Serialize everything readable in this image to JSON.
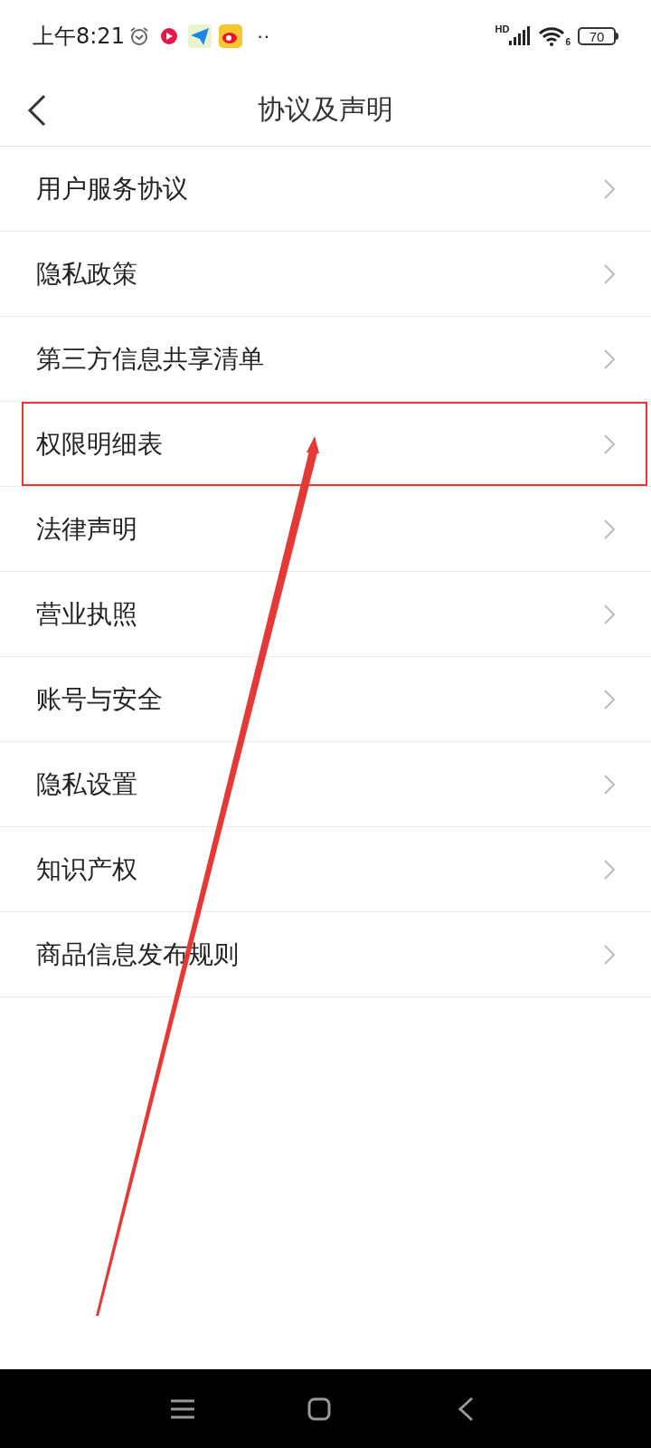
{
  "status_bar": {
    "time": "上午8:21",
    "network": "HD",
    "wifi_badge": "6",
    "battery": "70",
    "more": "··"
  },
  "header": {
    "title": "协议及声明"
  },
  "items": [
    {
      "label": "用户服务协议",
      "highlighted": false
    },
    {
      "label": "隐私政策",
      "highlighted": false
    },
    {
      "label": "第三方信息共享清单",
      "highlighted": false
    },
    {
      "label": "权限明细表",
      "highlighted": true
    },
    {
      "label": "法律声明",
      "highlighted": false
    },
    {
      "label": "营业执照",
      "highlighted": false
    },
    {
      "label": "账号与安全",
      "highlighted": false
    },
    {
      "label": "隐私设置",
      "highlighted": false
    },
    {
      "label": "知识产权",
      "highlighted": false
    },
    {
      "label": "商品信息发布规则",
      "highlighted": false
    }
  ]
}
